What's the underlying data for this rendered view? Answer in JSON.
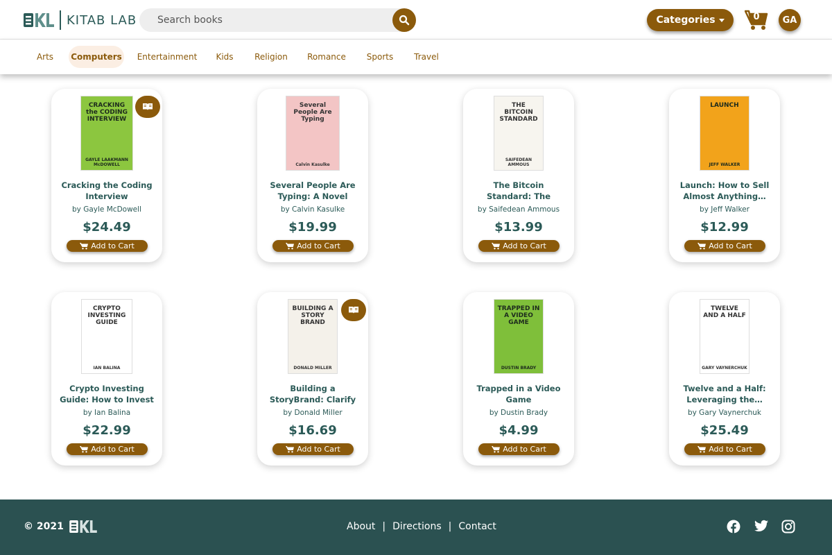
{
  "header": {
    "logo_text": "KITAB LAB",
    "search_placeholder": "Search books",
    "categories_label": "Categories",
    "cart_count": "0",
    "avatar_initials": "GA"
  },
  "categories": [
    "Arts",
    "Computers",
    "Entertainment",
    "Kids",
    "Religion",
    "Romance",
    "Sports",
    "Travel"
  ],
  "active_category": "Computers",
  "colors": {
    "brand": "#8b5a0b",
    "teal": "#2b5151",
    "active_bg": "#fbeee3"
  },
  "books": [
    {
      "title": "Cracking the Coding Interview",
      "author": "by Gayle McDowell",
      "price": "$24.49",
      "add_label": "Add to Cart",
      "has_badge": true,
      "cover": {
        "bg": "#8cc63f",
        "text": "CRACKING the CODING INTERVIEW",
        "foot": "GAYLE LAAKMANN McDOWELL"
      }
    },
    {
      "title": "Several People Are Typing: A Novel",
      "author": "by Calvin Kasulke",
      "price": "$19.99",
      "add_label": "Add to Cart",
      "has_badge": false,
      "cover": {
        "bg": "#f3c5c5",
        "text": "Several People Are Typing",
        "foot": "Calvin Kasulke"
      }
    },
    {
      "title": "The Bitcoin Standard: The Decentralized…",
      "author": "by Saifedean Ammous",
      "price": "$13.99",
      "add_label": "Add to Cart",
      "has_badge": false,
      "cover": {
        "bg": "#f7f5ef",
        "text": "THE BITCOIN STANDARD",
        "foot": "SAIFEDEAN AMMOUS"
      }
    },
    {
      "title": "Launch: How to Sell Almost Anything…",
      "author": "by Jeff Walker",
      "price": "$12.99",
      "add_label": "Add to Cart",
      "has_badge": false,
      "cover": {
        "bg": "#f2a31b",
        "text": "LAUNCH",
        "foot": "JEFF WALKER"
      }
    },
    {
      "title": "Crypto Investing Guide: How to Invest in…",
      "author": "by Ian Balina",
      "price": "$22.99",
      "add_label": "Add to Cart",
      "has_badge": false,
      "cover": {
        "bg": "#ffffff",
        "text": "CRYPTO INVESTING GUIDE",
        "foot": "IAN BALINA"
      }
    },
    {
      "title": "Building a StoryBrand: Clarify Your Message…",
      "author": "by Donald Miller",
      "price": "$16.69",
      "add_label": "Add to Cart",
      "has_badge": true,
      "cover": {
        "bg": "#f4f1ea",
        "text": "BUILDING A STORY BRAND",
        "foot": "DONALD MILLER"
      }
    },
    {
      "title": "Trapped in a Video Game",
      "author": "by Dustin Brady",
      "price": "$4.99",
      "add_label": "Add to Cart",
      "has_badge": false,
      "cover": {
        "bg": "#7fbf3a",
        "text": "TRAPPED IN A VIDEO GAME",
        "foot": "DUSTIN BRADY"
      }
    },
    {
      "title": "Twelve and a Half: Leveraging the…",
      "author": "by Gary Vaynerchuk",
      "price": "$25.49",
      "add_label": "Add to Cart",
      "has_badge": false,
      "cover": {
        "bg": "#ffffff",
        "text": "TWELVE AND A HALF",
        "foot": "GARY VAYNERCHUK"
      }
    }
  ],
  "footer": {
    "copyright": "© 2021",
    "links": [
      "About",
      "Directions",
      "Contact"
    ],
    "separator": "|",
    "social": [
      "facebook-icon",
      "twitter-icon",
      "instagram-icon"
    ]
  }
}
